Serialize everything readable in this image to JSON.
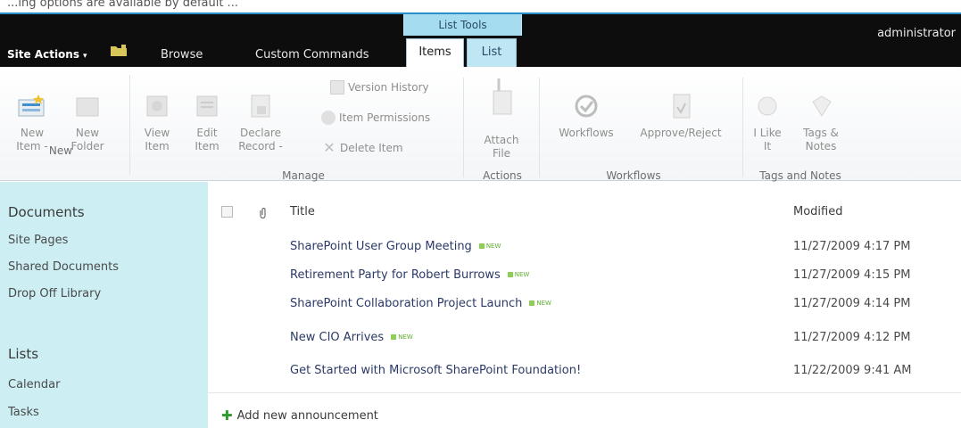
{
  "caption": "...ing options are available by default ...",
  "header": {
    "site_actions": "Site Actions",
    "site_actions_caret": "▾",
    "browse": "Browse",
    "custom_commands": "Custom Commands",
    "contextual_group": "List Tools",
    "tab_items": "Items",
    "tab_list": "List",
    "user": "administrator"
  },
  "ribbon": {
    "new_item": [
      "New",
      "Item -"
    ],
    "new_folder": [
      "New",
      "Folder"
    ],
    "view_item": [
      "View",
      "Item"
    ],
    "edit_item": [
      "Edit",
      "Item"
    ],
    "declare_record": [
      "Declare",
      "Record -"
    ],
    "version_history": "Version History",
    "item_permissions": "Item Permissions",
    "delete_item": "Delete Item",
    "attach_file": [
      "Attach",
      "File"
    ],
    "workflows": "Workflows",
    "approve_reject": "Approve/Reject",
    "i_like_it": [
      "I Like",
      "It"
    ],
    "tags_notes": [
      "Tags &",
      "Notes"
    ],
    "groups": {
      "new": "New",
      "manage": "Manage",
      "actions": "Actions",
      "workflows": "Workflows",
      "tags": "Tags and Notes"
    }
  },
  "nav": {
    "documents": "Documents",
    "site_pages": "Site Pages",
    "shared_documents": "Shared Documents",
    "drop_off_library": "Drop Off Library",
    "lists": "Lists",
    "calendar": "Calendar",
    "tasks": "Tasks"
  },
  "list": {
    "col_title": "Title",
    "col_modified": "Modified",
    "new_badge": "NEW",
    "rows": [
      {
        "title": "SharePoint User Group Meeting",
        "modified": "11/27/2009 4:17 PM",
        "is_new": true
      },
      {
        "title": "Retirement Party for Robert Burrows",
        "modified": "11/27/2009 4:15 PM",
        "is_new": true
      },
      {
        "title": "SharePoint Collaboration Project Launch",
        "modified": "11/27/2009 4:14 PM",
        "is_new": true
      },
      {
        "title": "New CIO Arrives",
        "modified": "11/27/2009 4:12 PM",
        "is_new": true
      },
      {
        "title": "Get Started with Microsoft SharePoint Foundation!",
        "modified": "11/22/2009 9:41 AM",
        "is_new": false
      }
    ],
    "add_new": "Add new announcement"
  },
  "colors": {
    "header_bg": "#0d0d0d",
    "contextual_tab": "#a5dcef",
    "left_nav_bg": "#cdeff4",
    "link": "#2b3a66",
    "new_badge": "#8fcf55"
  }
}
